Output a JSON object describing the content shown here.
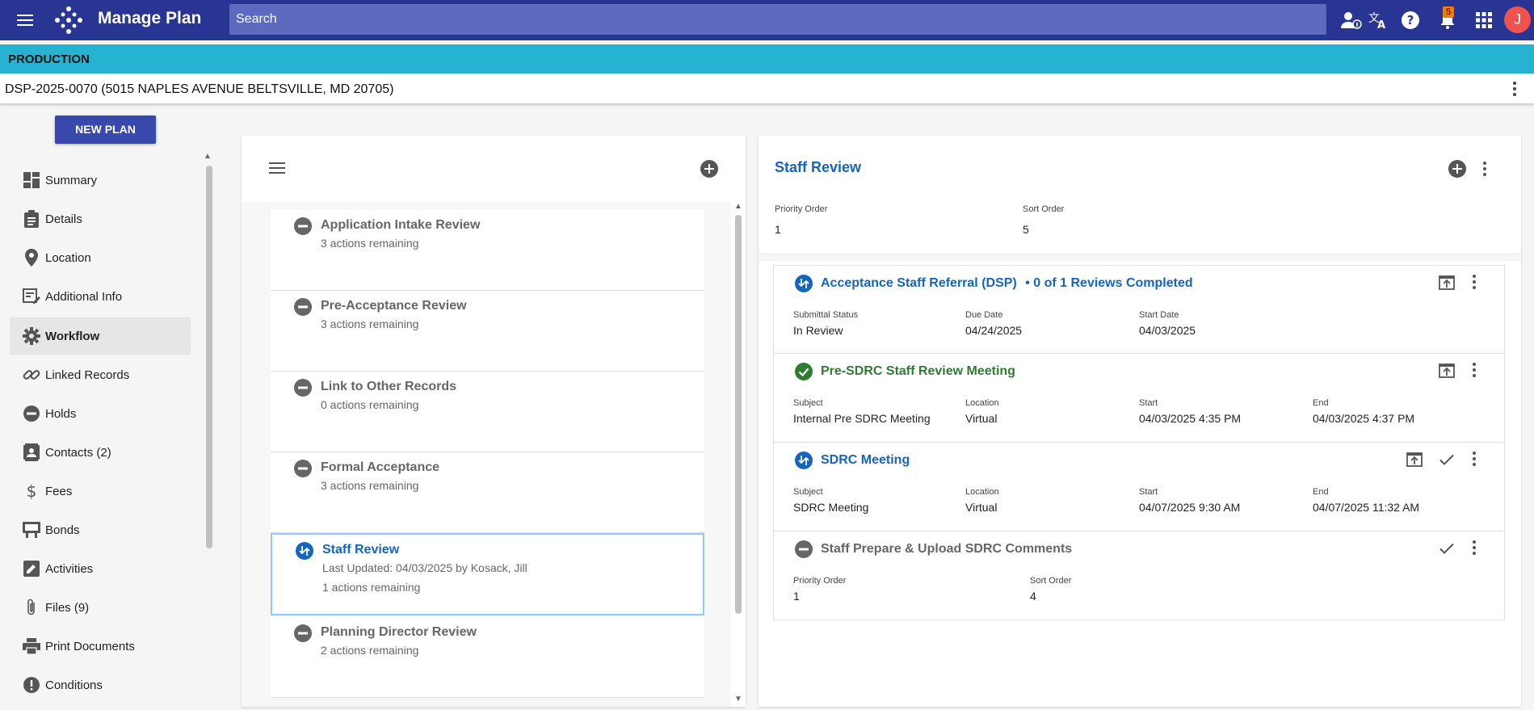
{
  "header": {
    "title": "Manage Plan",
    "search_placeholder": "Search",
    "notification_count": "5",
    "avatar_initial": "J"
  },
  "environment": {
    "label": "PRODUCTION"
  },
  "record": {
    "title": "DSP-2025-0070 (5015 NAPLES AVENUE BELTSVILLE, MD 20705)"
  },
  "new_plan_label": "NEW PLAN",
  "sidebar": {
    "items": [
      {
        "label": "Summary",
        "icon": "dashboard-icon"
      },
      {
        "label": "Details",
        "icon": "clipboard-icon"
      },
      {
        "label": "Location",
        "icon": "location-pin-icon"
      },
      {
        "label": "Additional Info",
        "icon": "form-edit-icon"
      },
      {
        "label": "Workflow",
        "icon": "gear-icon",
        "active": true
      },
      {
        "label": "Linked Records",
        "icon": "link-icon"
      },
      {
        "label": "Holds",
        "icon": "minus-circle-icon"
      },
      {
        "label": "Contacts (2)",
        "icon": "contact-card-icon"
      },
      {
        "label": "Fees",
        "icon": "dollar-icon"
      },
      {
        "label": "Bonds",
        "icon": "bond-icon"
      },
      {
        "label": "Activities",
        "icon": "edit-square-icon"
      },
      {
        "label": "Files (9)",
        "icon": "paperclip-icon"
      },
      {
        "label": "Print Documents",
        "icon": "printer-icon"
      },
      {
        "label": "Conditions",
        "icon": "alert-circle-icon"
      }
    ]
  },
  "workflow": {
    "tasks": [
      {
        "name": "Application Intake Review",
        "sub": "3 actions remaining",
        "status": "minus"
      },
      {
        "name": "Pre-Acceptance Review",
        "sub": "3 actions remaining",
        "status": "minus"
      },
      {
        "name": "Link to Other Records",
        "sub": "0 actions remaining",
        "status": "minus"
      },
      {
        "name": "Formal Acceptance",
        "sub": "3 actions remaining",
        "status": "minus"
      },
      {
        "name": "Staff Review",
        "sub": "Last Updated: 04/03/2025 by Kosack, Jill",
        "sub2": "1 actions remaining",
        "status": "in-progress"
      },
      {
        "name": "Planning Director Review",
        "sub": "2 actions remaining",
        "status": "minus"
      }
    ]
  },
  "detail": {
    "title": "Staff Review",
    "priority_label": "Priority Order",
    "priority_value": "1",
    "sort_label": "Sort Order",
    "sort_value": "5",
    "cards": [
      {
        "title": "Acceptance Staff Referral (DSP)",
        "suffix": "• 0 of 1 Reviews Completed",
        "fields": [
          {
            "label": "Submittal Status",
            "value": "In Review"
          },
          {
            "label": "Due Date",
            "value": "04/24/2025"
          },
          {
            "label": "Start Date",
            "value": "04/03/2025"
          }
        ]
      },
      {
        "title": "Pre-SDRC Staff Review Meeting",
        "fields": [
          {
            "label": "Subject",
            "value": "Internal Pre SDRC Meeting"
          },
          {
            "label": "Location",
            "value": "Virtual"
          },
          {
            "label": "Start",
            "value": "04/03/2025 4:35 PM"
          },
          {
            "label": "End",
            "value": "04/03/2025 4:37 PM"
          }
        ]
      },
      {
        "title": "SDRC Meeting",
        "fields": [
          {
            "label": "Subject",
            "value": "SDRC Meeting"
          },
          {
            "label": "Location",
            "value": "Virtual"
          },
          {
            "label": "Start",
            "value": "04/07/2025 9:30 AM"
          },
          {
            "label": "End",
            "value": "04/07/2025 11:32 AM"
          }
        ]
      },
      {
        "title": "Staff Prepare & Upload SDRC Comments",
        "fields": [
          {
            "label": "Priority Order",
            "value": "1"
          },
          {
            "label": "Sort Order",
            "value": "4"
          }
        ]
      }
    ]
  },
  "colors": {
    "topbar": "#283593",
    "envbar": "#26b3d1",
    "accent_blue": "#1565c0",
    "complete_green": "#2e7d32"
  }
}
